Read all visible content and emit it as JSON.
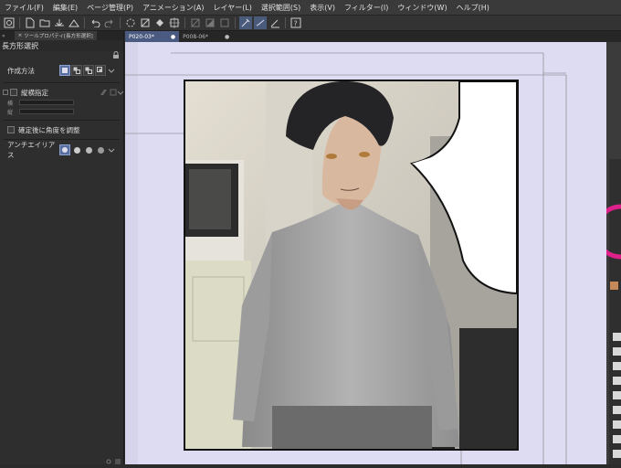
{
  "menubar": {
    "items": [
      "ファイル(F)",
      "編集(E)",
      "ページ管理(P)",
      "アニメーション(A)",
      "レイヤー(L)",
      "選択範囲(S)",
      "表示(V)",
      "フィルター(I)",
      "ウィンドウ(W)",
      "ヘルプ(H)"
    ]
  },
  "panel": {
    "tab_label": "ツールプロパティ[長方形選択]",
    "title": "長方形選択",
    "creation_method_label": "作成方法",
    "aspect_label": "縦横指定",
    "width_label": "横",
    "height_label": "縦",
    "adjust_angle_label": "確定後に角度を調整",
    "antialias_label": "アンチエイリアス"
  },
  "doc_tabs": [
    {
      "label": "P020-03*",
      "close": "●"
    },
    {
      "label": "P008-06*",
      "close": "●"
    }
  ],
  "icons": {
    "close_tab": "×",
    "collapse": "«",
    "expand": "»"
  },
  "colors": {
    "canvas_bg": "#dedcf3",
    "active_tab": "#4a5a80",
    "selected_tool": "#5a6fa0",
    "panel_bg": "#2e2e2e",
    "menubar_bg": "#3a3a3a"
  }
}
